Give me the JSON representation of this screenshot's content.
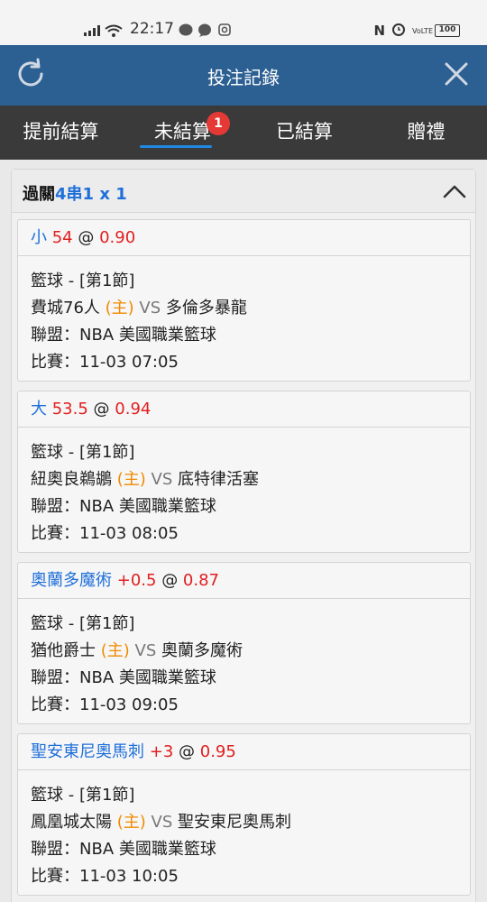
{
  "status_bar": {
    "time": "22:17",
    "network": "VoLTE",
    "battery": "100"
  },
  "header": {
    "title": "投注記錄",
    "refresh_icon": "refresh-icon",
    "close_icon": "close-icon"
  },
  "tabs": [
    {
      "label": "提前結算"
    },
    {
      "label": "未結算",
      "badge": "1",
      "active": true
    },
    {
      "label": "已結算"
    },
    {
      "label": "贈禮"
    }
  ],
  "parlay": {
    "label": "過關",
    "type": "4串1 x 1"
  },
  "bets": [
    {
      "selection": "小",
      "line": "54",
      "at": "@",
      "odds": "0.90",
      "sport": "籃球 - [第1節]",
      "home": "費城76人",
      "home_tag": "(主)",
      "vs": "VS",
      "away": "多倫多暴龍",
      "league": "聯盟：NBA 美國職業籃球",
      "match": "比賽：11-03 07:05"
    },
    {
      "selection": "大",
      "line": "53.5",
      "at": "@",
      "odds": "0.94",
      "sport": "籃球 - [第1節]",
      "home": "紐奧良鵜鶘",
      "home_tag": "(主)",
      "vs": "VS",
      "away": "底特律活塞",
      "league": "聯盟：NBA 美國職業籃球",
      "match": "比賽：11-03 08:05"
    },
    {
      "selection": "奧蘭多魔術",
      "line": "+0.5",
      "at": "@",
      "odds": "0.87",
      "sport": "籃球 - [第1節]",
      "home": "猶他爵士",
      "home_tag": "(主)",
      "vs": "VS",
      "away": "奧蘭多魔術",
      "league": "聯盟：NBA 美國職業籃球",
      "match": "比賽：11-03 09:05"
    },
    {
      "selection": "聖安東尼奧馬刺",
      "line": "+3",
      "at": "@",
      "odds": "0.95",
      "sport": "籃球 - [第1節]",
      "home": "鳳凰城太陽",
      "home_tag": "(主)",
      "vs": "VS",
      "away": "聖安東尼奧馬刺",
      "league": "聯盟：NBA 美國職業籃球",
      "match": "比賽：11-03 10:05"
    }
  ],
  "colors": {
    "header_bg": "#2c5f92",
    "tab_bg": "#3a3a3a",
    "accent_blue": "#1e6fd9",
    "odds_red": "#e02020",
    "home_orange": "#f08a00",
    "badge_red": "#e53935"
  }
}
